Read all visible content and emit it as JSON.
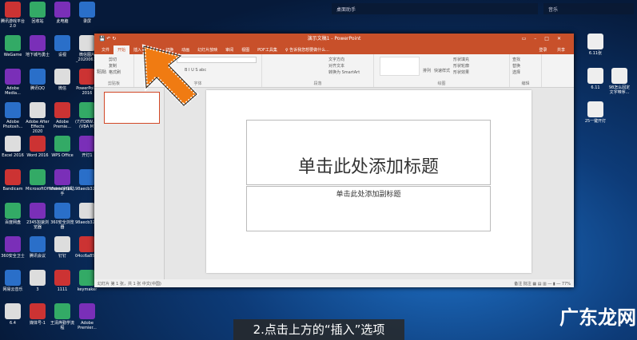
{
  "desktop": {
    "icons": [
      [
        "腾讯游戏平台2.0",
        "回收站",
        "此电脑",
        "录屏"
      ],
      [
        "WeGame",
        "地下城与勇士",
        "设视",
        "微信图片_20200611"
      ],
      [
        "Adobe Media...",
        "腾讯QQ",
        "微信",
        "PowerPoint 2016"
      ],
      [
        "Adobe Photosh...",
        "Adobe After Effects 2020",
        "Adobe Premie...",
        "(7)TD8W...~(VBA M)"
      ],
      [
        "Excel 2016",
        "Word 2016",
        "WPS Office",
        "开灯1"
      ],
      [
        "Bandicam",
        "MicrosoftOfficeInstallat...",
        "iFonts字体助手",
        "98aecb3257d5e2e"
      ],
      [
        "百度网盘",
        "2345加速浏览器",
        "360安全浏览器",
        "98aecb3257d5e2e"
      ],
      [
        "360安全卫士",
        "腾讯会议",
        "钉钉",
        "04cc6a85eefc4770"
      ],
      [
        "网易云音乐",
        "3",
        "1111",
        "keymaker"
      ],
      [
        "6.4",
        "媒体号-1",
        "王清烨勤学流程",
        "Adobe Premier..."
      ]
    ],
    "right_icons": [
      "6.11张",
      "6.11",
      "98怎么固定文字带序...",
      "25一键开灯"
    ]
  },
  "topbars": [
    "桌面助手",
    "音乐"
  ],
  "window": {
    "title": "演示文稿1 - PowerPoint",
    "tabs": [
      "文件",
      "开始",
      "插入",
      "设计",
      "切换",
      "动画",
      "幻灯片放映",
      "审阅",
      "视图",
      "PDF工具集",
      "♀ 告诉我您想要做什么..."
    ],
    "login": "登录",
    "share": "共享",
    "groups": [
      "剪贴板",
      "字体",
      "段落",
      "绘图",
      "编辑"
    ],
    "clipboard": [
      "粘贴",
      "剪切",
      "复制",
      "格式刷"
    ],
    "paragraph_items": [
      "文字方向",
      "对齐文本",
      "转换为 SmartArt"
    ],
    "drawing_items": [
      "排列",
      "快速样式",
      "形状填充",
      "形状轮廓",
      "形状效果"
    ],
    "editing_items": [
      "查找",
      "替换",
      "选择"
    ],
    "slide_title": "单击此处添加标题",
    "slide_subtitle": "单击此处添加副标题",
    "status_left": "幻灯片 第 1 张，共 1 张    中文(中国)",
    "notes": "备注",
    "comments": "批注",
    "zoom": "77%"
  },
  "subtitle": "2.点击上方的“插入”选项",
  "watermark": "广东龙网"
}
